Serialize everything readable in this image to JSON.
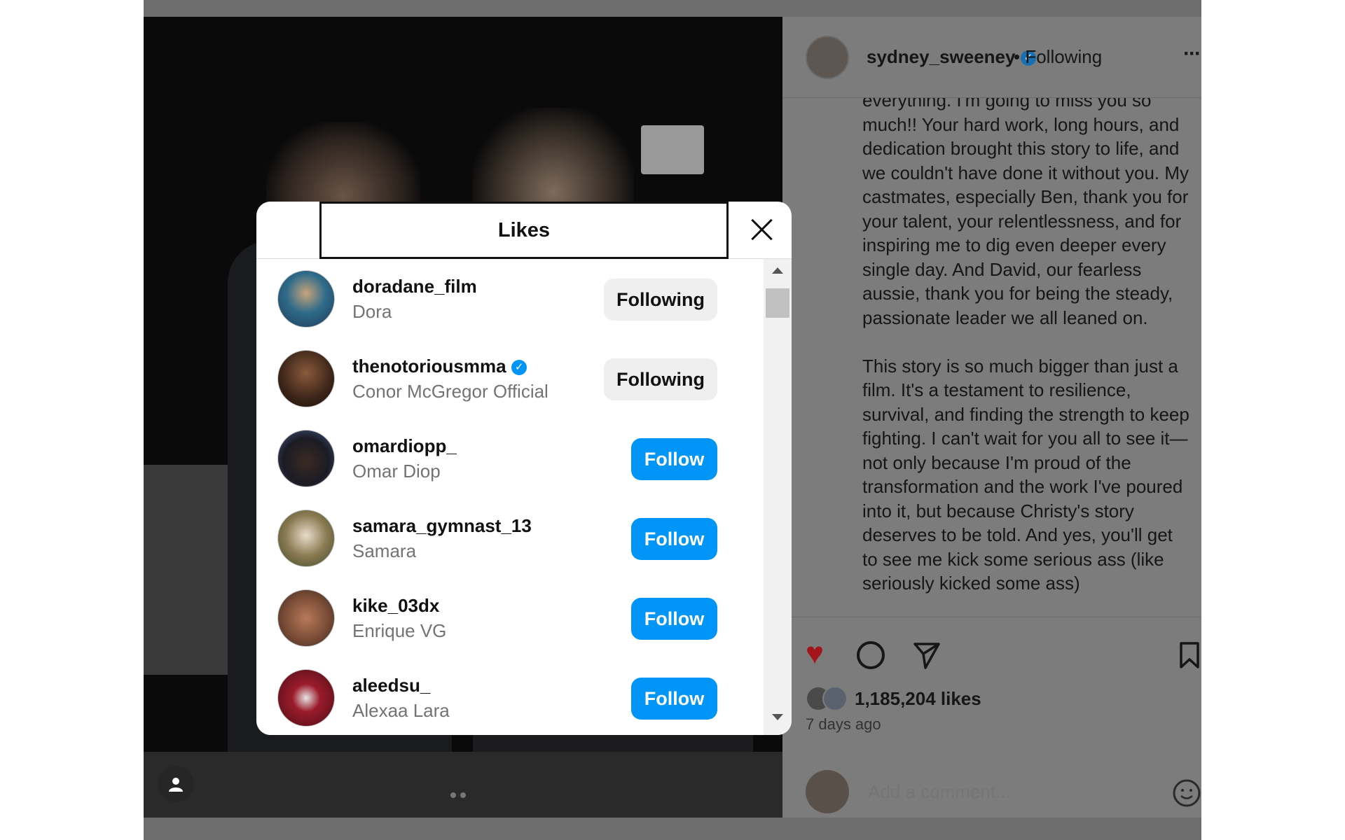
{
  "post": {
    "username": "sydney_sweeney",
    "follow_state": "• Following",
    "more_label": "···",
    "caption": "everything. I'm going to miss you so much!! Your hard work, long hours, and dedication brought this story to life, and we couldn't have done it without you. My castmates, especially Ben, thank you for your talent, your relentlessness, and for inspiring me to dig even deeper every single day. And David, our fearless aussie, thank you for being the steady, passionate leader we all leaned on.\n\nThis story is so much bigger than just a film. It's a testament to resilience, survival, and finding the strength to keep fighting. I can't wait for you all to see it—not only because I'm proud of the transformation and the work I've poured into it, but because Christy's story deserves to be told. And yes, you'll get to see me kick some serious ass (like seriously kicked some ass)",
    "likes_count": "1,185,204 likes",
    "time_ago": "7 days ago",
    "comment_placeholder": "Add a comment...",
    "liked_color": "#a4141b"
  },
  "modal": {
    "title": "Likes",
    "rows": [
      {
        "username": "doradane_film",
        "name": "Dora",
        "verified": false,
        "button": "Following"
      },
      {
        "username": "thenotoriousmma",
        "name": "Conor McGregor Official",
        "verified": true,
        "button": "Following"
      },
      {
        "username": "omardiopp_",
        "name": "Omar Diop",
        "verified": false,
        "button": "Follow"
      },
      {
        "username": "samara_gymnast_13",
        "name": "Samara",
        "verified": false,
        "button": "Follow"
      },
      {
        "username": "kike_03dx",
        "name": "Enrique VG",
        "verified": false,
        "button": "Follow"
      },
      {
        "username": "aleedsu_",
        "name": "Alexaa Lara",
        "verified": false,
        "button": "Follow"
      }
    ]
  },
  "colors": {
    "follow_button": "#0095f6",
    "following_button": "#efefef",
    "verified_badge": "#0095f6"
  }
}
